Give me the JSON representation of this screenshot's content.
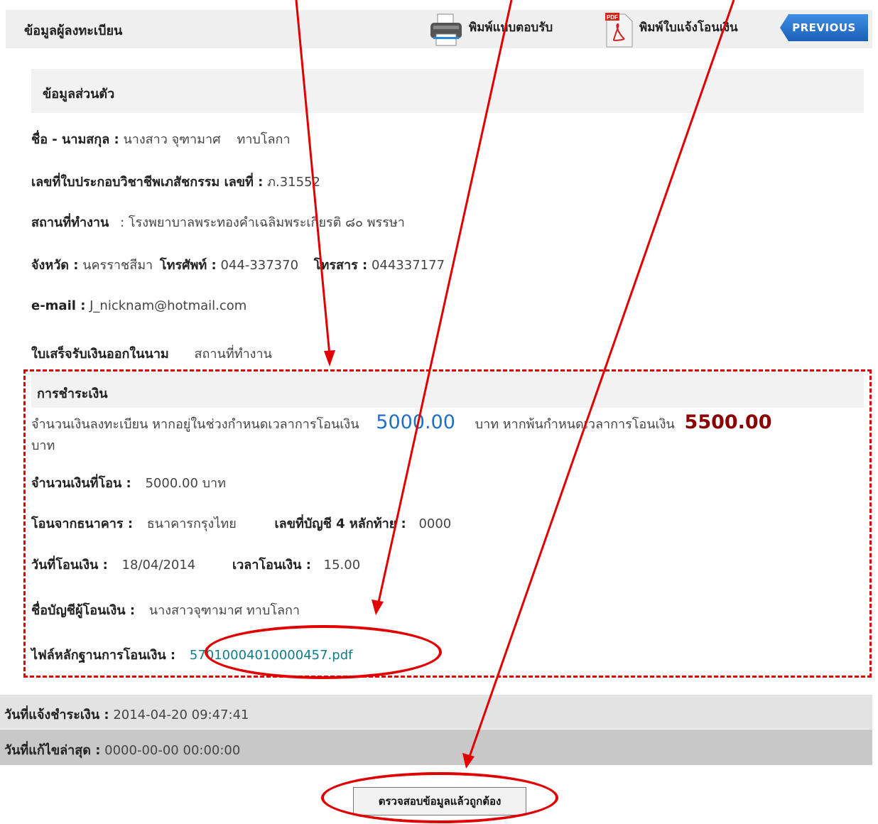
{
  "header": {
    "title": "ข้อมูลผู้ลงทะเบียน",
    "print_form_label": "พิมพ์แบบตอบรับ",
    "print_transfer_label": "พิมพ์ใบแจ้งโอนเงิน",
    "previous_label": "PREVIOUS"
  },
  "personal": {
    "section_title": "ข้อมูลส่วนตัว",
    "name_label": "ชื่อ - นามสกุล :",
    "name_value": "นางสาว จุฑามาศ    ทาบโลกา",
    "license_label": "เลขที่ใบประกอบวิชาชีพเภสัชกรรม  เลขที่ :",
    "license_value": "ภ.31552",
    "workplace_label": "สถานที่ทำงาน",
    "workplace_value": ": โรงพยาบาลพระทองคำเฉลิมพระเกียรติ ๘๐ พรรษา",
    "province_label": "จังหวัด :",
    "province_value": "นครราชสีมา",
    "phone_label": "โทรศัพท์ :",
    "phone_value": "044-337370",
    "fax_label": "โทรสาร  :",
    "fax_value": "044337177",
    "email_label": "e-mail :",
    "email_value": "J_nicknam@hotmail.com",
    "receipt_label": "ใบเสร็จรับเงินออกในนาม",
    "receipt_value": "สถานที่ทำงาน"
  },
  "payment": {
    "section_title": "การชำระเงิน",
    "fee_text_1": "จำนวนเงินลงทะเบียน หากอยู่ในช่วงกำหนดเวลาการโอนเงิน",
    "fee_on_time": "5000.00",
    "fee_text_2": "บาท หากพ้นกำหนดเวลาการโอนเงิน",
    "fee_late": "5500.00",
    "fee_unit": "บาท",
    "amount_label": "จำนวนเงินที่โอน  :",
    "amount_value": "5000.00 บาท",
    "bank_label": "โอนจากธนาคาร  :",
    "bank_value": "ธนาคารกรุงไทย",
    "account_label": "เลขที่บัญชี 4 หลักท้าย  :",
    "account_value": "0000",
    "date_label": "วันที่โอนเงิน  :",
    "date_value": "18/04/2014",
    "time_label": "เวลาโอนเงิน  :",
    "time_value": "15.00",
    "account_name_label": "ชื่อบัญชีผู้โอนเงิน  :",
    "account_name_value": "นางสาวจุฑามาศ ทาบโลกา",
    "file_label": "ไฟล์หลักฐานการโอนเงิน  :",
    "file_value": "57010004010000457.pdf"
  },
  "footer": {
    "notified_label": "วันที่แจ้งชำระเงิน :",
    "notified_value": "2014-04-20 09:47:41",
    "modified_label": "วันที่แก้ไขล่าสุด :",
    "modified_value": "0000-00-00 00:00:00"
  },
  "confirm_button_label": "ตรวจสอบข้อมูลแล้วถูกต้อง",
  "annotation_color": "#e00000"
}
